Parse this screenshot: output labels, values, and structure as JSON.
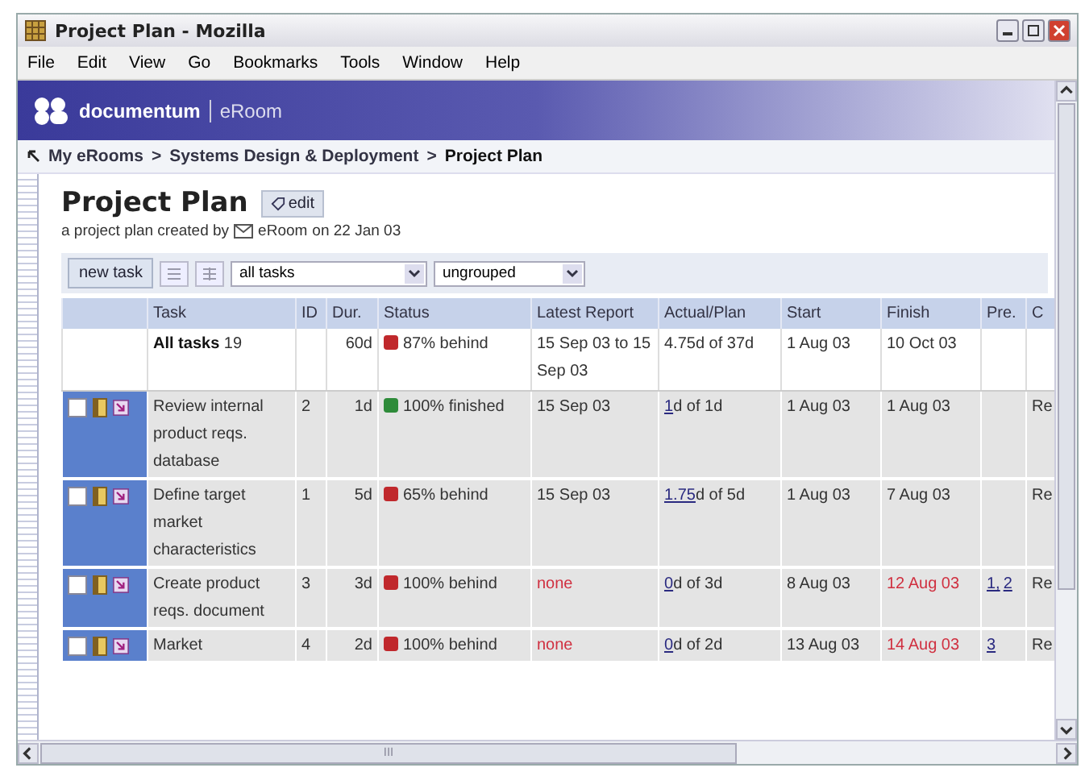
{
  "window": {
    "title": "Project Plan - Mozilla"
  },
  "menu": [
    "File",
    "Edit",
    "View",
    "Go",
    "Bookmarks",
    "Tools",
    "Window",
    "Help"
  ],
  "brand": {
    "name": "documentum",
    "product": "eRoom"
  },
  "breadcrumb": [
    {
      "label": "My eRooms",
      "current": false
    },
    {
      "label": "Systems Design & Deployment",
      "current": false
    },
    {
      "label": "Project Plan",
      "current": true
    }
  ],
  "breadcrumb_separator": ">",
  "page": {
    "title": "Project Plan",
    "edit": "edit",
    "subtitle_before": "a project plan created by",
    "author": "eRoom",
    "subtitle_after": "on 22 Jan 03"
  },
  "toolbar": {
    "new_task": "new task",
    "filter": "all tasks",
    "grouping": "ungrouped"
  },
  "table": {
    "columns": [
      "Task",
      "ID",
      "Dur.",
      "Status",
      "Latest Report",
      "Actual/Plan",
      "Start",
      "Finish",
      "Pre.",
      "C"
    ],
    "summary": {
      "task": "All tasks",
      "count": "19",
      "dur": "60d",
      "status": "87% behind",
      "color": "#c0282c",
      "latest": "15 Sep 03 to 15 Sep 03",
      "actual": "4.75d of 37d",
      "start": "1 Aug 03",
      "finish": "10 Oct 03"
    },
    "rows": [
      {
        "checked": false,
        "task": "Review internal product reqs. database",
        "id": "2",
        "dur": "1d",
        "status": "100% finished",
        "color": "#2e8b3a",
        "latest": "15 Sep 03",
        "latest_late": false,
        "actual_link": "1",
        "actual_rest": "d of 1d",
        "start": "1 Aug 03",
        "finish": "1 Aug 03",
        "finish_late": false,
        "pre": [],
        "col10": "Re"
      },
      {
        "checked": false,
        "task": "Define target market characteristics",
        "id": "1",
        "dur": "5d",
        "status": "65% behind",
        "color": "#c0282c",
        "latest": "15 Sep 03",
        "latest_late": false,
        "actual_link": "1.75",
        "actual_rest": "d of 5d",
        "start": "1 Aug 03",
        "finish": "7 Aug 03",
        "finish_late": false,
        "pre": [],
        "col10": "Re"
      },
      {
        "checked": false,
        "task": "Create product reqs. document",
        "id": "3",
        "dur": "3d",
        "status": "100% behind",
        "color": "#c0282c",
        "latest": "none",
        "latest_late": true,
        "actual_link": "0",
        "actual_rest": "d of 3d",
        "start": "8 Aug 03",
        "finish": "12 Aug 03",
        "finish_late": true,
        "pre": [
          "1,",
          "2"
        ],
        "col10": "Re"
      },
      {
        "checked": false,
        "task": "Market",
        "id": "4",
        "dur": "2d",
        "status": "100% behind",
        "color": "#c0282c",
        "latest": "none",
        "latest_late": true,
        "actual_link": "0",
        "actual_rest": "d of 2d",
        "start": "13 Aug 03",
        "finish": "14 Aug 03",
        "finish_late": true,
        "pre": [
          "3"
        ],
        "col10": "Re"
      }
    ]
  },
  "scrollbar_grip": "III"
}
